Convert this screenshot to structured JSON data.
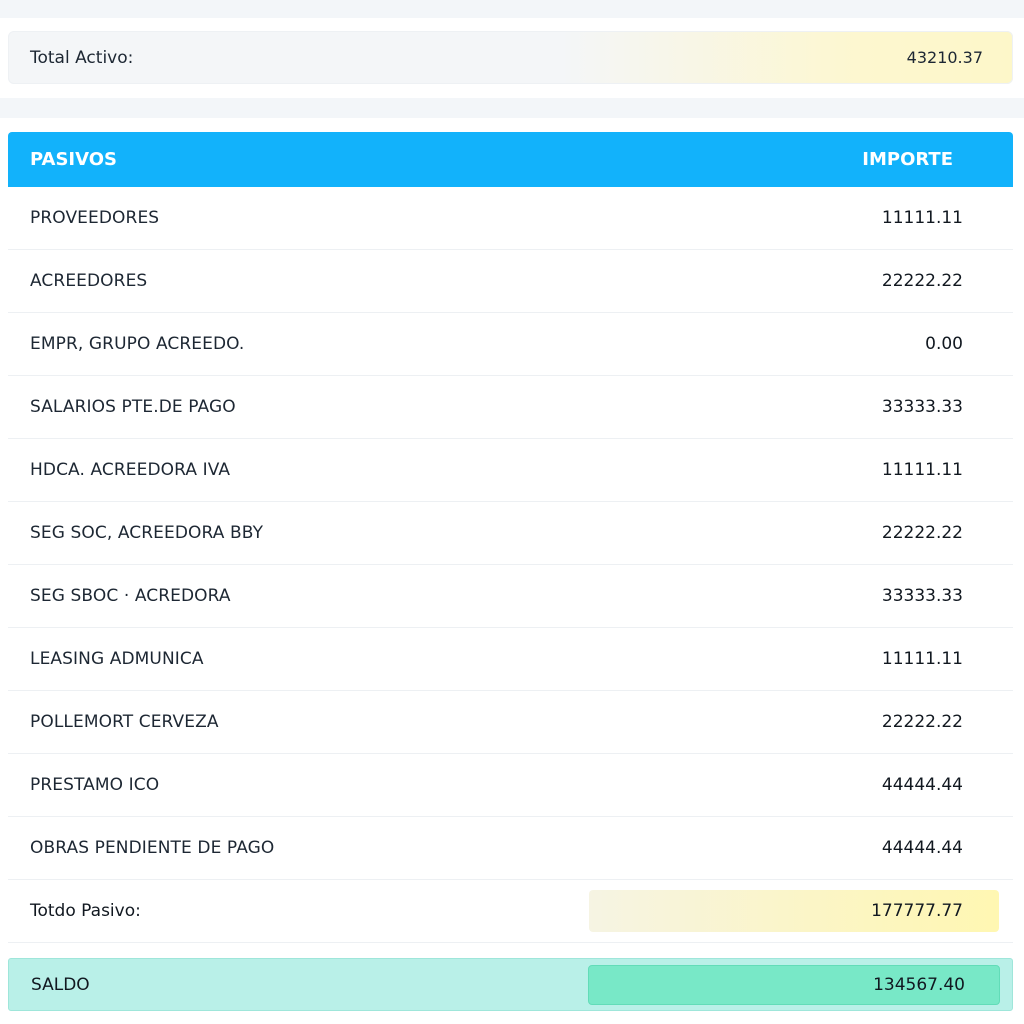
{
  "total_activo": {
    "label": "Total Activo:",
    "value": "43210.37"
  },
  "table": {
    "header": {
      "col_name": "PASIVOS",
      "col_amount": "IMPORTE"
    },
    "rows": [
      {
        "name": "PROVEEDORES",
        "amount": "11111.11"
      },
      {
        "name": "ACREEDORES",
        "amount": "22222.22"
      },
      {
        "name": "EMPR, GRUPO ACREEDO.",
        "amount": "0.00"
      },
      {
        "name": "SALARIOS PTE.DE PAGO",
        "amount": "33333.33"
      },
      {
        "name": "HDCA. ACREEDORA IVA",
        "amount": "11111.11"
      },
      {
        "name": "SEG SOC, ACREEDORA BBY",
        "amount": "22222.22"
      },
      {
        "name": "SEG SBOC · ACREDORA",
        "amount": "33333.33"
      },
      {
        "name": "LEASING ADMUNICA",
        "amount": "11111.11"
      },
      {
        "name": "POLLEMORT CERVEZA",
        "amount": "22222.22"
      },
      {
        "name": "PRESTAMO ICO",
        "amount": "44444.44"
      },
      {
        "name": "OBRAS PENDIENTE DE PAGO",
        "amount": "44444.44"
      }
    ]
  },
  "total_pasivo": {
    "label": "Totdo Pasivo:",
    "value": "177777.77"
  },
  "saldo": {
    "label": "SALDO",
    "value": "134567.40"
  },
  "colors": {
    "header_bg": "#12b2fb",
    "saldo_bg": "#b9f0e8",
    "saldo_value_bg": "#78e8c7",
    "total_highlight": "#fff7b2"
  }
}
